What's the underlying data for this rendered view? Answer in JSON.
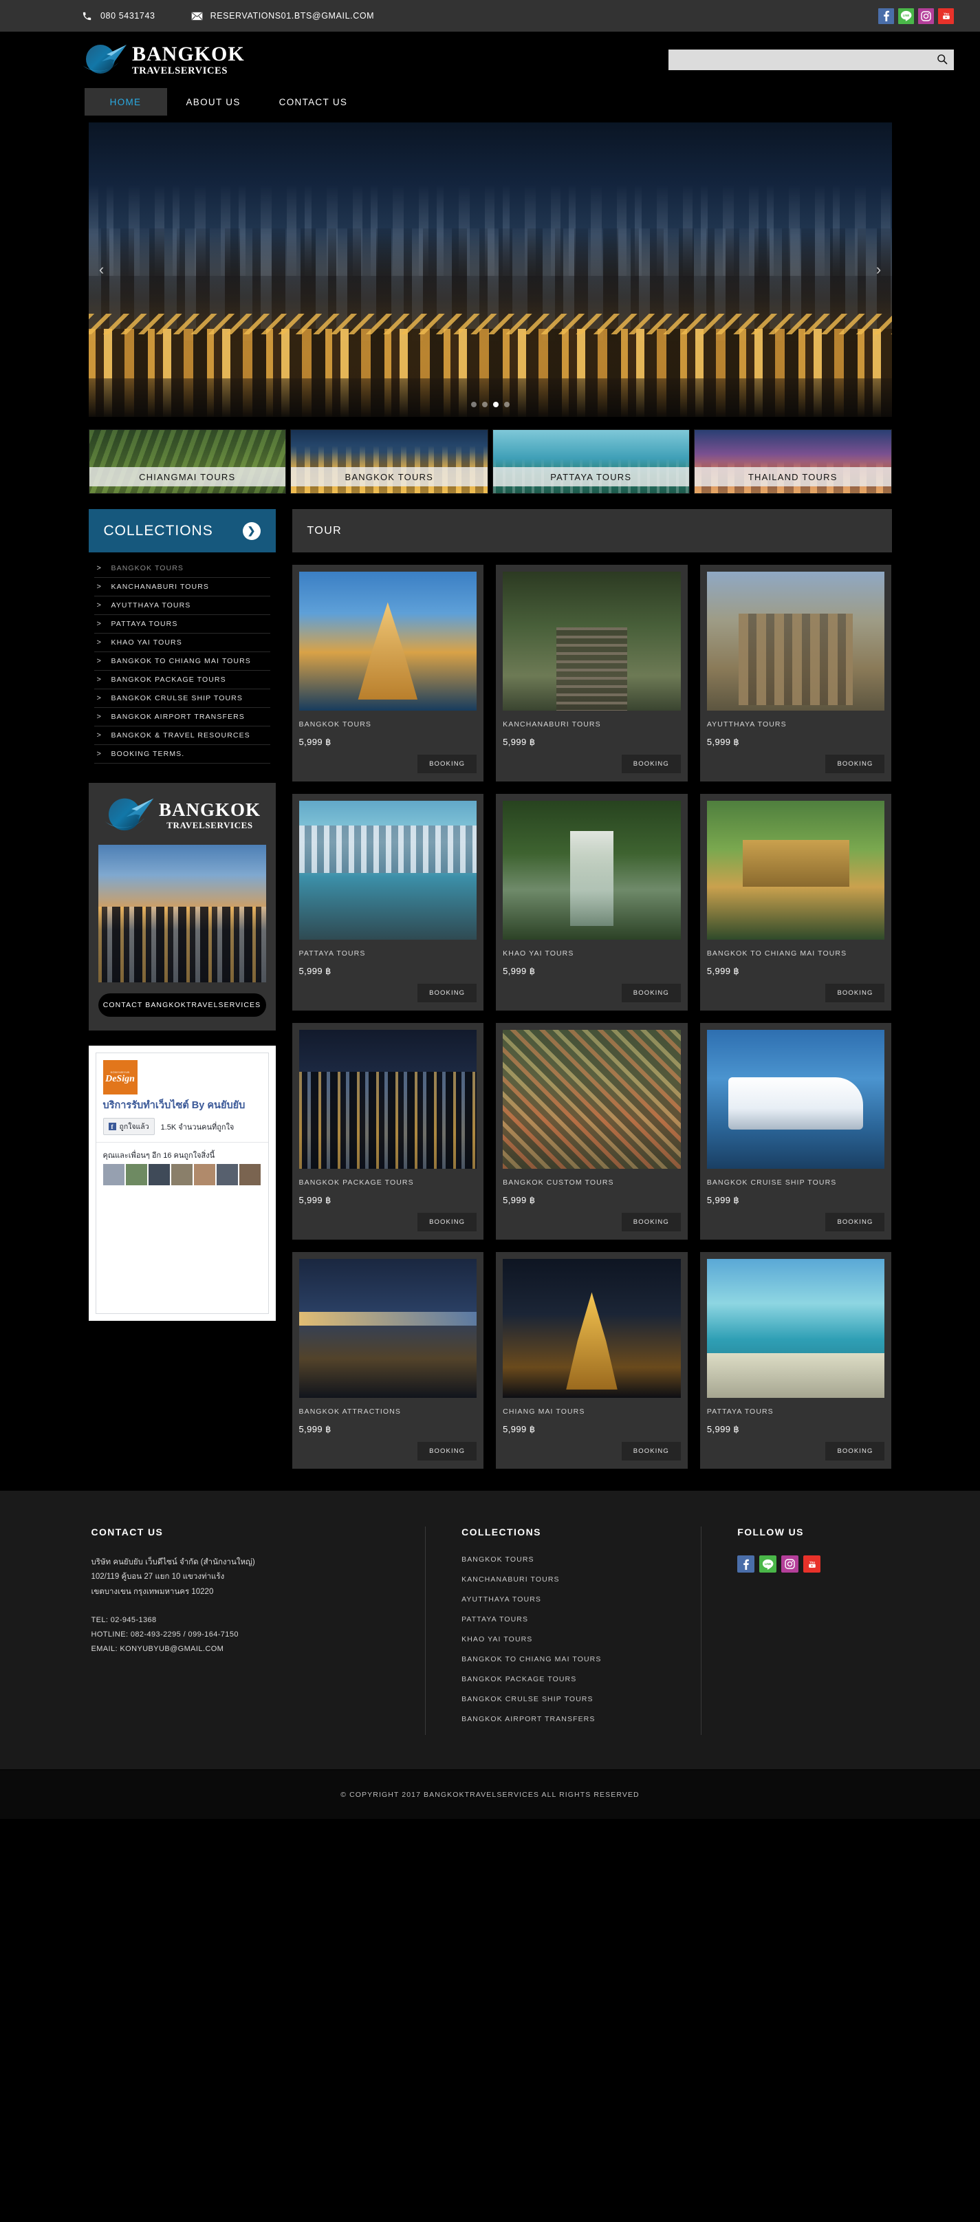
{
  "topbar": {
    "phone": "080  5431743",
    "email": "RESERVATIONS01.BTS@GMAIL.COM",
    "social": [
      {
        "name": "facebook",
        "glyph": "f"
      },
      {
        "name": "line",
        "glyph": "LINE"
      },
      {
        "name": "instagram",
        "glyph": "ig"
      },
      {
        "name": "youtube",
        "glyph": "yt"
      }
    ]
  },
  "header": {
    "logo_line1": "BANGKOK",
    "logo_line2": "TRAVELSERVICES",
    "search_value": "",
    "search_placeholder": ""
  },
  "nav": {
    "items": [
      {
        "label": "HOME",
        "active": true
      },
      {
        "label": "ABOUT US",
        "active": false
      },
      {
        "label": "CONTACT US",
        "active": false
      }
    ]
  },
  "hero": {
    "slides_total": 4,
    "active_slide": 3,
    "prev_label": "‹",
    "next_label": "›"
  },
  "categories": [
    {
      "label": "CHIANGMAI TOURS"
    },
    {
      "label": "BANGKOK TOURS"
    },
    {
      "label": "PATTAYA TOURS"
    },
    {
      "label": "THAILAND TOURS"
    }
  ],
  "sidebar": {
    "collections_title": "COLLECTIONS",
    "arrow": "❯",
    "items": [
      {
        "label": "BANGKOK TOURS",
        "dim": true
      },
      {
        "label": "KANCHANABURI TOURS",
        "dim": false
      },
      {
        "label": "AYUTTHAYA TOURS",
        "dim": false
      },
      {
        "label": "PATTAYA TOURS",
        "dim": false
      },
      {
        "label": "KHAO YAI TOURS",
        "dim": false
      },
      {
        "label": "BANGKOK TO CHIANG MAI TOURS",
        "dim": false
      },
      {
        "label": "BANGKOK PACKAGE TOURS",
        "dim": false
      },
      {
        "label": "BANGKOK CRULSE SHIP TOURS",
        "dim": false
      },
      {
        "label": "BANGKOK AIRPORT TRANSFERS",
        "dim": false
      },
      {
        "label": "BANGKOK & TRAVEL RESOURCES",
        "dim": false
      },
      {
        "label": "BOOKING TERMS.",
        "dim": false
      }
    ],
    "promo": {
      "logo_line1": "BANGKOK",
      "logo_line2": "TRAVELSERVICES",
      "button_label": "CONTACT  BANGKOKTRAVELSERVICES"
    },
    "facebook": {
      "avatar_top": "KONYUBYUB",
      "avatar_text": "DeSign",
      "page_title": "บริการรับทำเว็บไซต์ By คนยับยับ",
      "like_label": "ถูกใจแล้ว",
      "like_count": "1.5K จำนวนคนที่ถูกใจ",
      "friends_line": "คุณและเพื่อนๆ อีก 16 คนถูกใจสิ่งนี้"
    }
  },
  "content": {
    "section_title": "TOUR",
    "booking_label": "BOOKING",
    "cards": [
      {
        "title": "BANGKOK TOURS",
        "price": "5,999 ฿",
        "art": "a-wat"
      },
      {
        "title": "KANCHANABURI TOURS",
        "price": "5,999 ฿",
        "art": "a-rail"
      },
      {
        "title": "AYUTTHAYA TOURS",
        "price": "5,999 ฿",
        "art": "a-ruin"
      },
      {
        "title": "PATTAYA TOURS",
        "price": "5,999 ฿",
        "art": "a-beachcity"
      },
      {
        "title": "KHAO YAI TOURS",
        "price": "5,999 ฿",
        "art": "a-falls"
      },
      {
        "title": "BANGKOK TO CHIANG MAI TOURS",
        "price": "5,999 ฿",
        "art": "a-garden"
      },
      {
        "title": "BANGKOK PACKAGE TOURS",
        "price": "5,999 ฿",
        "art": "a-nightcity"
      },
      {
        "title": "BANGKOK CUSTOM TOURS",
        "price": "5,999 ฿",
        "art": "a-market"
      },
      {
        "title": "BANGKOK CRUISE SHIP TOURS",
        "price": "5,999 ฿",
        "art": "a-cruise"
      },
      {
        "title": "BANGKOK ATTRACTIONS",
        "price": "5,999 ฿",
        "art": "a-bridge"
      },
      {
        "title": "CHIANG MAI TOURS",
        "price": "5,999 ฿",
        "art": "a-templenight"
      },
      {
        "title": "PATTAYA TOURS",
        "price": "5,999 ฿",
        "art": "a-beach"
      }
    ]
  },
  "footer": {
    "contact_title": "CONTACT US",
    "address_l1": "บริษัท คนยับยับ เว็บดีไซน์ จำกัด (สำนักงานใหญ่)",
    "address_l2": "102/119 คู้บอน 27 แยก 10 แขวงท่าแร้ง",
    "address_l3": "เขตบางเขน กรุงเทพมหานคร 10220",
    "tel": "TEL:  02-945-1368",
    "hotline": "HOTLINE: 082-493-2295  /  099-164-7150",
    "email": "EMAIL: KONYUBYUB@GMAIL.COM",
    "collections_title": "COLLECTIONS",
    "collections": [
      "BANGKOK TOURS",
      "KANCHANABURI TOURS",
      "AYUTTHAYA TOURS",
      "PATTAYA TOURS",
      "KHAO YAI TOURS",
      "BANGKOK TO CHIANG MAI TOURS",
      "BANGKOK PACKAGE TOURS",
      "BANGKOK CRULSE SHIP TOURS",
      "BANGKOK AIRPORT TRANSFERS"
    ],
    "follow_title": "FOLLOW US",
    "copyright": "© COPYRIGHT 2017 BANGKOKTRAVELSERVICES  ALL RIGHTS RESERVED"
  }
}
